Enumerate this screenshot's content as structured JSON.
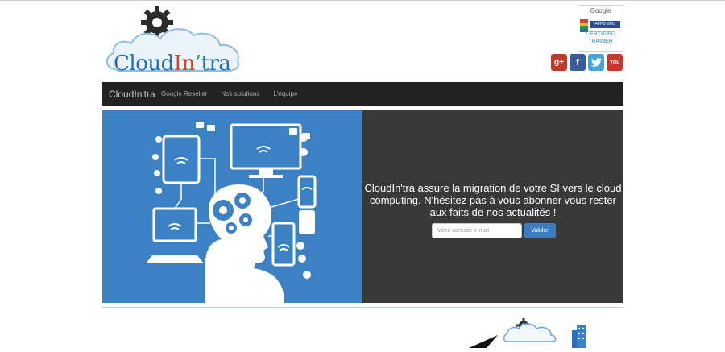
{
  "logo": {
    "parts": [
      "Cloud",
      "In",
      "’",
      "tra"
    ]
  },
  "badge": {
    "google": "Google",
    "apps": "APPS EDU",
    "certified": "CERTIFIED",
    "trainer": "TRAINER"
  },
  "social": {
    "google_plus": "g+",
    "facebook": "f",
    "twitter": "t",
    "youtube": "You"
  },
  "navbar": {
    "brand": "CloudIn'tra",
    "items": [
      "Google Reseller",
      "Nos solutions",
      "L'équipe"
    ]
  },
  "hero": {
    "text": "CloudIn'tra assure la migration de votre SI vers le cloud computing. N'hésitez pas à vous abonner vous rester aux faits de nos actualités !",
    "email_placeholder": "Votre adresse e-mail",
    "submit_label": "Valider"
  },
  "colors": {
    "navbar_bg": "#222222",
    "hero_left_bg": "#3b81c3",
    "hero_right_bg": "#393939",
    "button_bg": "#3a7ec0"
  }
}
